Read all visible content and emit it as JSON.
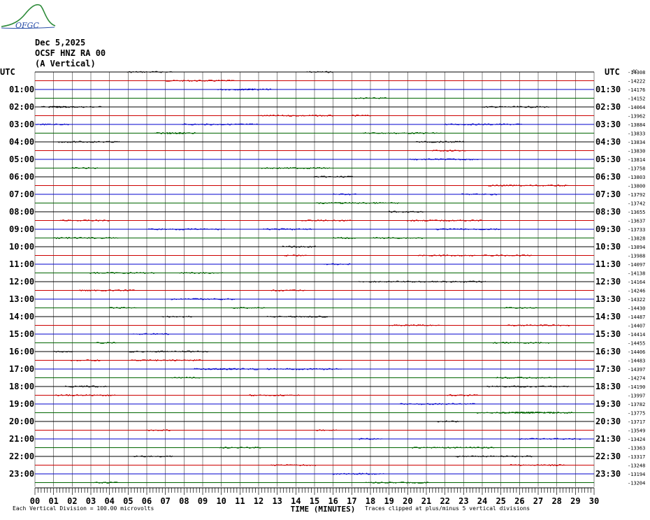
{
  "header": {
    "date": "Dec 5,2025",
    "station": "OCSF HNZ RA 00",
    "component": "(A Vertical)",
    "logo_text": "OFGC"
  },
  "chart_data": {
    "type": "line",
    "title": "",
    "left_axis_title": "UTC",
    "right_axis_title": "UTC",
    "right_values_header": "0C",
    "xlabel": "TIME (MINUTES)",
    "xlim": [
      0,
      30
    ],
    "x_ticks": [
      "00",
      "01",
      "02",
      "03",
      "04",
      "05",
      "06",
      "07",
      "08",
      "09",
      "10",
      "11",
      "12",
      "13",
      "14",
      "15",
      "16",
      "17",
      "18",
      "19",
      "20",
      "21",
      "22",
      "23",
      "24",
      "25",
      "26",
      "27",
      "28",
      "29",
      "30"
    ],
    "left_labels": [
      "UTC",
      "01:00",
      "02:00",
      "03:00",
      "04:00",
      "05:00",
      "06:00",
      "07:00",
      "08:00",
      "09:00",
      "10:00",
      "11:00",
      "12:00",
      "13:00",
      "14:00",
      "15:00",
      "16:00",
      "17:00",
      "18:00",
      "19:00",
      "20:00",
      "21:00",
      "22:00",
      "23:00"
    ],
    "right_labels": [
      "UTC",
      "01:30",
      "02:30",
      "03:30",
      "04:30",
      "05:30",
      "06:30",
      "07:30",
      "08:30",
      "09:30",
      "10:30",
      "11:30",
      "12:30",
      "13:30",
      "14:30",
      "15:30",
      "16:30",
      "17:30",
      "18:30",
      "19:30",
      "20:30",
      "21:30",
      "22:30",
      "23:30"
    ],
    "trace_values": [
      -14308,
      -14222,
      -14176,
      -14152,
      -14064,
      -13962,
      -13884,
      -13833,
      -13834,
      -13830,
      -13814,
      -13758,
      -13803,
      -13800,
      -13792,
      -13742,
      -13655,
      -13637,
      -13733,
      -13828,
      -13894,
      -13988,
      -14097,
      -14138,
      -14164,
      -14246,
      -14322,
      -14430,
      -14487,
      -14407,
      -14414,
      -14455,
      -14406,
      -14483,
      -14397,
      -14274,
      -14190,
      -13997,
      -13782,
      -13775,
      -13717,
      -13549,
      -13424,
      -13363,
      -13317,
      -13248,
      -13194,
      -13204
    ],
    "trace_colors": [
      "#000000",
      "#cc0000",
      "#0000cc",
      "#006600"
    ],
    "vertical_division": "Each Vertical Division =  100.00 microvolts",
    "clip_note": "Traces clipped at plus/minus 5 vertical divisions",
    "grid": true
  }
}
